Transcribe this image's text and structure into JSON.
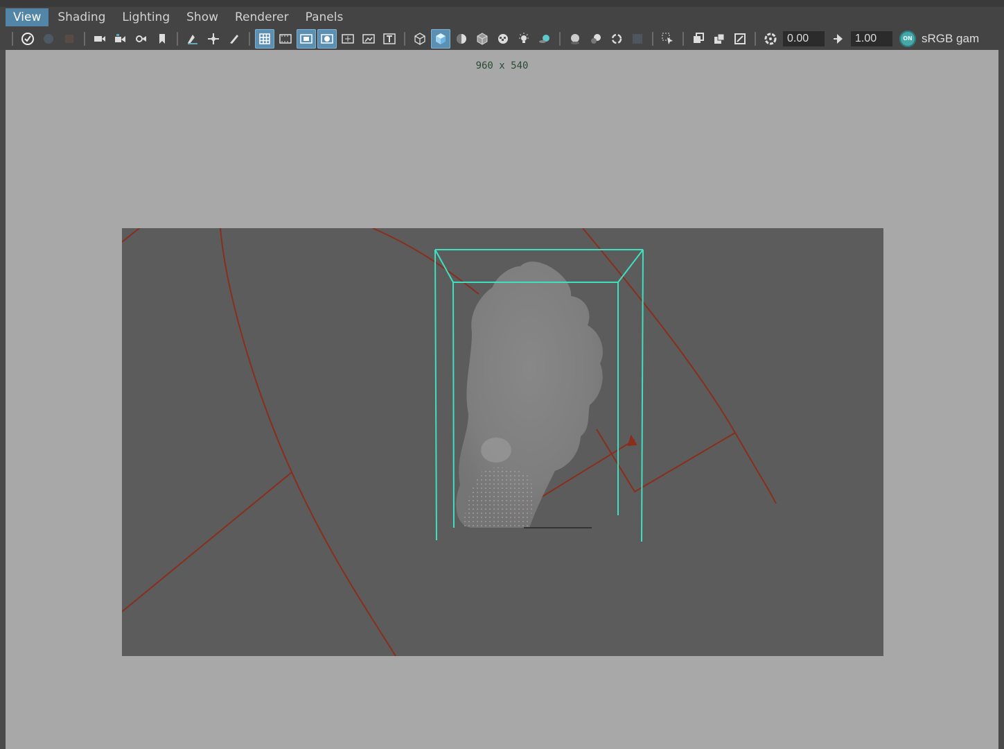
{
  "menubar": {
    "items": [
      "View",
      "Shading",
      "Lighting",
      "Show",
      "Renderer",
      "Panels"
    ]
  },
  "toolbar": {
    "exposure_value": "0.00",
    "gamma_value": "1.00",
    "color_management_toggle": "ON",
    "color_space": "sRGB gam",
    "icons": [
      "select-camera-icon",
      "camera-attributes-icon",
      "bookmarks-icon",
      "image-plane-icon",
      "two-d-pan-zoom-icon",
      "grease-pencil-icon",
      "grid-icon",
      "film-gate-icon",
      "resolution-gate-icon",
      "gate-mask-icon",
      "field-chart-icon",
      "safe-action-icon",
      "safe-title-icon",
      "wireframe-icon",
      "smooth-shade-icon",
      "wireframe-on-shaded-icon",
      "default-material-icon",
      "textured-icon",
      "use-lights-icon",
      "shadows-icon",
      "screen-space-ao-icon",
      "motion-blur-icon",
      "anti-aliasing-icon",
      "depth-of-field-icon",
      "isolate-select-icon",
      "xray-icon",
      "xray-active-icon",
      "xray-joints-icon",
      "exposure-icon",
      "gamma-icon",
      "color-management-icon"
    ]
  },
  "viewport": {
    "resolution_label": "960 x 540"
  },
  "colors": {
    "menu_active": "#5285a6",
    "toolbar_active": "#5d8fb1",
    "container_wireframe": "#3fe0c0",
    "curve_lines": "#8a2e1c",
    "viewport_bg": "#a8a8a8",
    "gate_bg": "#5c5c5c"
  }
}
